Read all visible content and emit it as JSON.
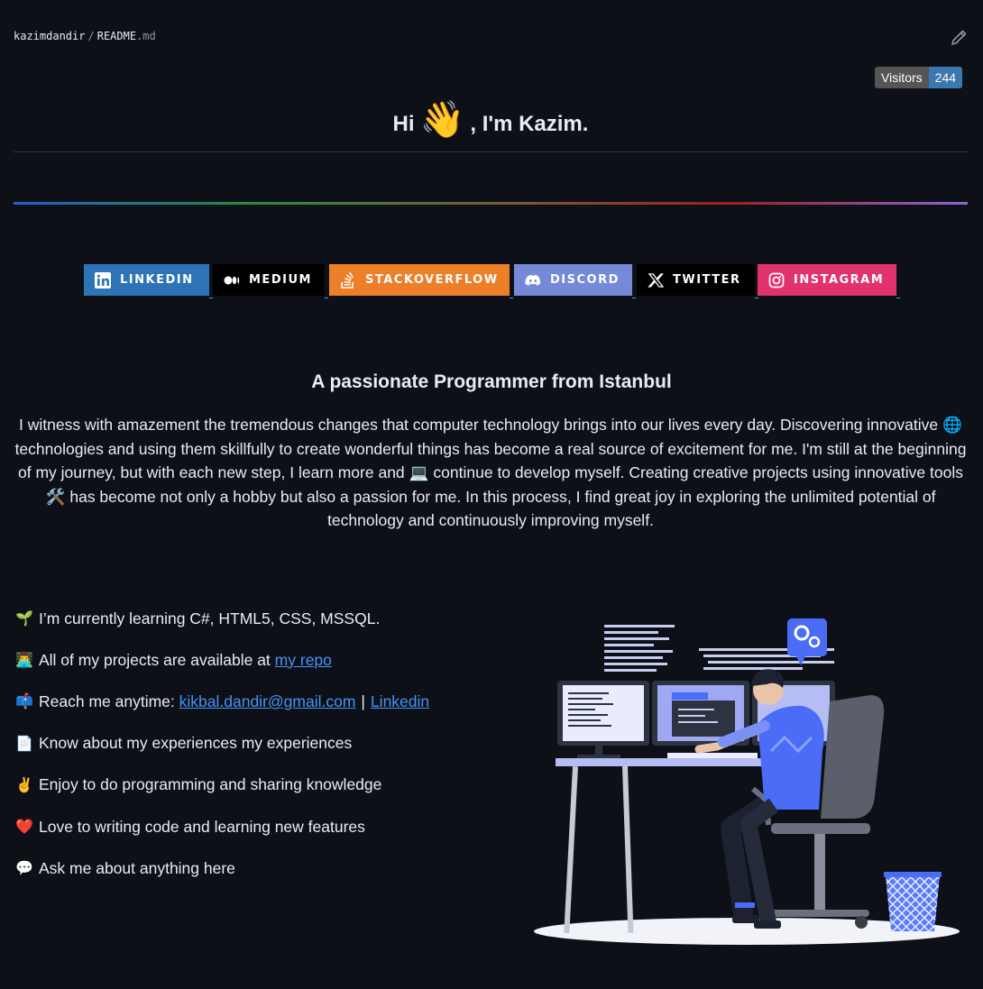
{
  "header": {
    "user": "kazimdandir",
    "separator": "/",
    "file_name": "README",
    "file_ext": ".md",
    "edit_icon": "pencil-icon"
  },
  "visitors": {
    "label": "Visitors",
    "count": "244"
  },
  "hero": {
    "before": "Hi",
    "wave": "👋",
    "after": ", I'm Kazim."
  },
  "badges": [
    {
      "label": "LINKEDIN",
      "icon": "linkedin-icon",
      "color": "#2d74b6"
    },
    {
      "label": "MEDIUM",
      "icon": "medium-icon",
      "color": "#000000"
    },
    {
      "label": "STACKOVERFLOW",
      "icon": "stackoverflow-icon",
      "color": "#ee7f29"
    },
    {
      "label": "DISCORD",
      "icon": "discord-icon",
      "color": "#7489d8"
    },
    {
      "label": "TWITTER",
      "icon": "x-icon",
      "color": "#000000"
    },
    {
      "label": "INSTAGRAM",
      "icon": "instagram-icon",
      "color": "#e0336c"
    }
  ],
  "subtitle": "A passionate Programmer from Istanbul",
  "intro": {
    "part1": "I witness with amazement the tremendous changes that computer technology brings into our lives every day. Discovering innovative",
    "emoji1": "🌐",
    "part2": "technologies and using them skillfully to create wonderful things has become a real source of excitement for me. I'm still at the beginning of my journey, but with each new step, I learn more and",
    "emoji2": "💻",
    "part3": "continue to develop myself. Creating creative projects using innovative tools",
    "emoji3": "🛠️",
    "part4": "has become not only a hobby but also a passion for me. In this process, I find great joy in exploring the unlimited potential of technology and continuously improving myself."
  },
  "facts": {
    "learning": {
      "icon": "🌱",
      "text": "I’m currently learning C#, HTML5, CSS, MSSQL."
    },
    "projects": {
      "icon": "👨‍💻",
      "text": "All of my projects are available at",
      "link": "my repo"
    },
    "reach": {
      "icon": "📫",
      "text": "Reach me anytime:",
      "email": "kikbal.dandir@gmail.com",
      "pipe": "|",
      "linkedin": "Linkedin"
    },
    "experience": {
      "icon": "📄",
      "text": "Know about my experiences my experiences"
    },
    "enjoy": {
      "icon": "✌️",
      "text": "Enjoy to do programming and sharing knowledge"
    },
    "love": {
      "icon": "❤️",
      "text": "Love to writing code and learning new features"
    },
    "ask": {
      "icon": "💬",
      "text": "Ask me about anything here"
    }
  },
  "illustration": {
    "name": "programmer-at-desk-illustration"
  }
}
